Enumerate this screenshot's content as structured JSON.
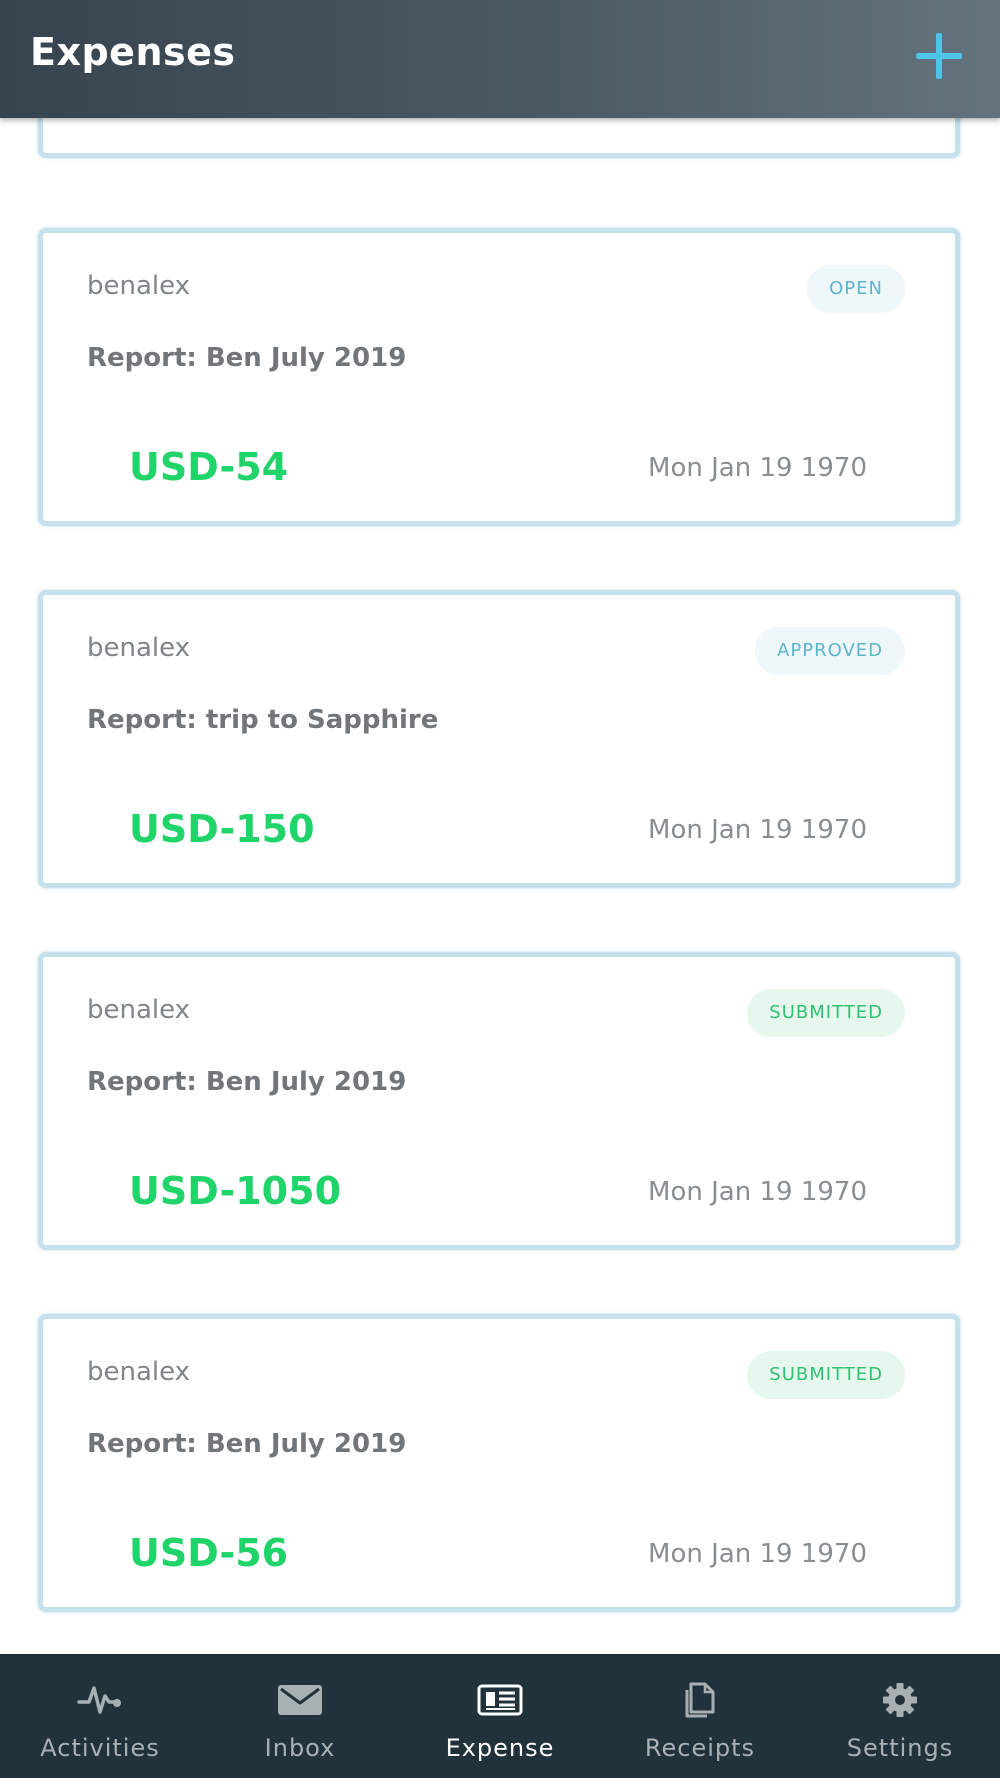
{
  "header": {
    "title": "Expenses",
    "add_icon": "plus-icon"
  },
  "expenses": [
    {
      "user": "benalex",
      "status": "OPEN",
      "status_color": "#5bb6cf",
      "report": "Report: Ben July 2019",
      "amount": "USD-54",
      "date": "Mon Jan 19 1970"
    },
    {
      "user": "benalex",
      "status": "APPROVED",
      "status_color": "#5bb6cf",
      "report": "Report: trip to Sapphire",
      "amount": "USD-150",
      "date": "Mon Jan 19 1970"
    },
    {
      "user": "benalex",
      "status": "SUBMITTED",
      "status_color": "#2ec271",
      "report": "Report: Ben July 2019",
      "amount": "USD-1050",
      "date": "Mon Jan 19 1970"
    },
    {
      "user": "benalex",
      "status": "SUBMITTED",
      "status_color": "#2ec271",
      "report": "Report: Ben July 2019",
      "amount": "USD-56",
      "date": "Mon Jan 19 1970"
    }
  ],
  "nav": {
    "items": [
      {
        "label": "Activities",
        "icon": "activity-pulse-icon"
      },
      {
        "label": "Inbox",
        "icon": "envelope-icon"
      },
      {
        "label": "Expense",
        "icon": "newspaper-icon",
        "active": true
      },
      {
        "label": "Receipts",
        "icon": "documents-icon"
      },
      {
        "label": "Settings",
        "icon": "gear-icon"
      }
    ]
  },
  "colors": {
    "header_bg": "#37444f",
    "accent": "#4fc3e8",
    "amount": "#20d46a",
    "card_border": "#c4e1ec",
    "nav_bg": "#22323a"
  }
}
